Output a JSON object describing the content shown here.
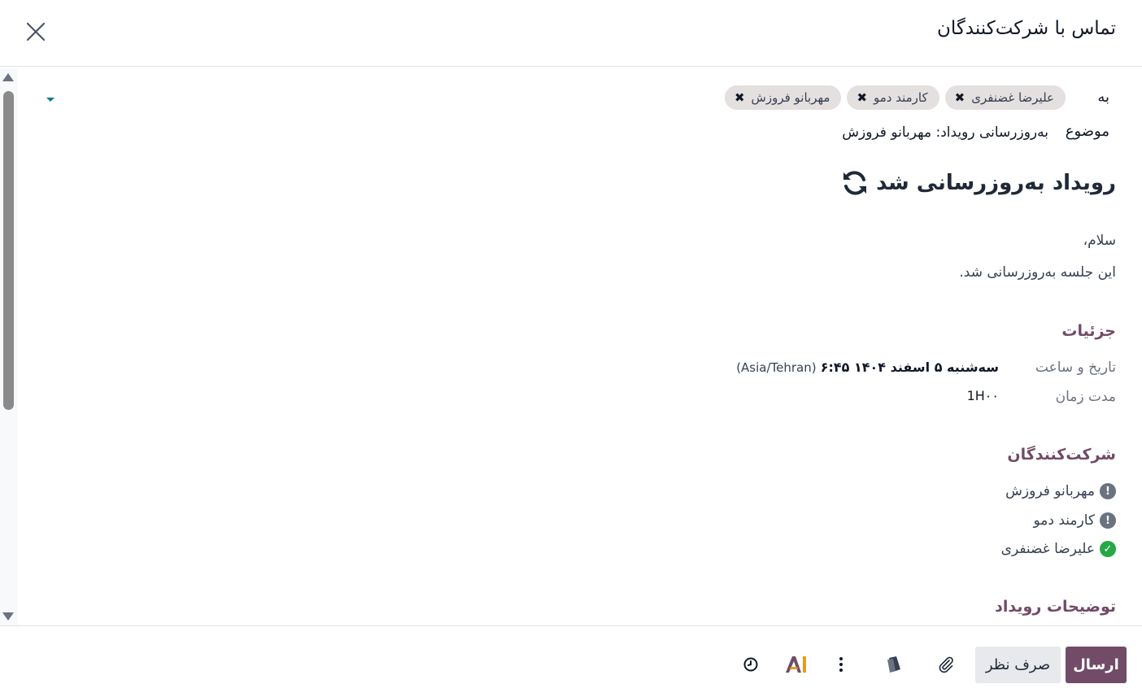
{
  "header": {
    "title": "تماس با شرکت‌کنندگان"
  },
  "recipients": {
    "label": "به",
    "tags": [
      {
        "name": "علیرضا غضنفری"
      },
      {
        "name": "کارمند دمو"
      },
      {
        "name": "مهربانو فروزش"
      }
    ]
  },
  "subject": {
    "label": "موضوع",
    "value": "به‌روزرسانی رویداد: مهربانو فروزش"
  },
  "mail": {
    "heading": "رویداد به‌روزرسانی شد",
    "greeting": "سلام،",
    "message": "این جلسه به‌روزرسانی شد.",
    "details_title": "جزئیات",
    "datetime_label": "تاریخ و ساعت",
    "datetime_value": "سه‌شنبه ۵ اسفند ۱۴۰۴ ۶:۴۵",
    "timezone": "(Asia/Tehran)",
    "duration_label": "مدت زمان",
    "duration_value": "1H۰۰",
    "attendees_title": "شرکت‌کنندگان",
    "attendees": [
      {
        "name": "مهربانو فروزش",
        "status": "pending",
        "status_icon": "exclamation-icon"
      },
      {
        "name": "کارمند دمو",
        "status": "pending",
        "status_icon": "exclamation-icon"
      },
      {
        "name": "علیرضا غضنفری",
        "status": "accepted",
        "status_icon": "check-icon"
      }
    ],
    "description_title": "توضیحات رویداد"
  },
  "footer": {
    "send_label": "ارسال",
    "discard_label": "صرف نظر",
    "icons": [
      "attachment-icon",
      "template-icon",
      "more-options-icon",
      "ai-icon",
      "schedule-clock-icon"
    ]
  },
  "colors": {
    "brand": "#714b67",
    "accent": "#017e84",
    "accepted": "#28a745",
    "pending": "#6b7280"
  }
}
